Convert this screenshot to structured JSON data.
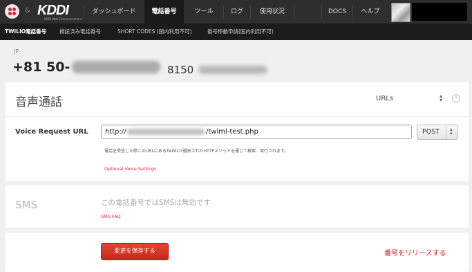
{
  "brand": {
    "logo_text": "KDDI",
    "logo_tagline": "KDDI Web Communications",
    "ampersand": "&"
  },
  "nav": {
    "items": [
      {
        "label": "ダッシュボード",
        "active": false
      },
      {
        "label": "電話番号",
        "active": true
      },
      {
        "label": "ツール",
        "active": false
      },
      {
        "label": "ログ",
        "active": false
      },
      {
        "label": "使用状況",
        "active": false
      }
    ],
    "right": [
      {
        "label": "DOCS"
      },
      {
        "label": "ヘルプ"
      }
    ]
  },
  "subnav": {
    "items": [
      {
        "label": "TWILIO電話番号",
        "active": true
      },
      {
        "label": "検証済み電話番号",
        "active": false
      },
      {
        "label": "SHORT CODES (国内利用不可)",
        "active": false
      },
      {
        "label": "番号移動申請(国内利用不可)",
        "active": false
      }
    ]
  },
  "number": {
    "country": "JP",
    "display_prefix": "+81 50-",
    "compact_prefix": "8150"
  },
  "voice": {
    "title": "音声通話",
    "config_mode": "URLs",
    "help_icon": "?",
    "request_url_label": "Voice Request URL",
    "url_prefix": "http://",
    "url_suffix": "/twiml-test.php",
    "method": "POST",
    "hint": "電話を受信した際このURLにあるTwiMLが選択されたHTTPメソッドを通じて検索、実行されます。",
    "optional_settings_link": "Optional Voice Settings"
  },
  "sms": {
    "title": "SMS",
    "disabled_text": "この電話番号ではSMSは無効です",
    "faq_link": "SMS FAQ"
  },
  "actions": {
    "save_label": "変更を保存する",
    "release_label": "番号をリリースする"
  },
  "colors": {
    "accent_red": "#d9232d",
    "topbar": "#2e2e2e",
    "subbar": "#1b1b1b",
    "background": "#f0f0f0"
  }
}
